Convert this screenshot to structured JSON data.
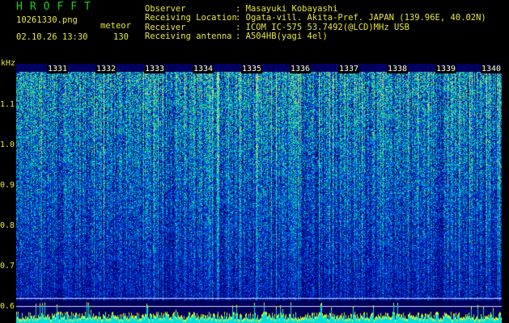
{
  "header": {
    "brand": "HROFFT",
    "filename": "10261330.png",
    "datetime": "02.10.26 13:30",
    "mode_label": "meteor",
    "mode_value": "130",
    "fields": [
      {
        "label": "Observer",
        "value": ": Masayuki Kobayashi"
      },
      {
        "label": "Receiving Location",
        "value": ": Ogata-vill. Akita-Pref. JAPAN (139.96E, 40.02N)"
      },
      {
        "label": "Receiver",
        "value": ": ICOM IC-575 53.7492(@LCD)MHz USB"
      },
      {
        "label": "Receiving antenna",
        "value": ": A504HB(yagi 4el)"
      }
    ]
  },
  "axis": {
    "unit": "kHz",
    "ticks": [
      "1.1",
      "1.0",
      "0.9",
      "0.8",
      "0.7",
      "0.6"
    ]
  },
  "time_marks": [
    "1331",
    "1332",
    "1333",
    "1334",
    "1335",
    "1336",
    "1337",
    "1338",
    "1339",
    "1340"
  ],
  "colors": {
    "text": "#e8e840",
    "brand": "#1ecf1e",
    "background": "#000000"
  }
}
